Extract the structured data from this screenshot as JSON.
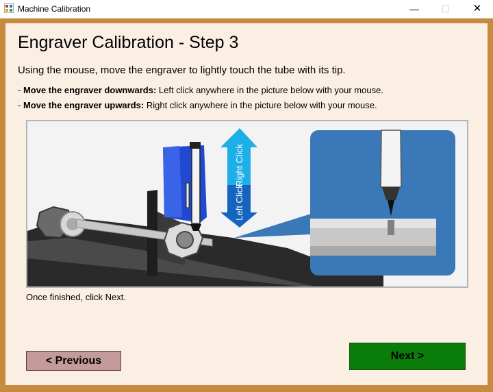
{
  "window": {
    "title": "Machine Calibration",
    "controls": {
      "minimize": "—",
      "maximize": "☐",
      "close": "✕"
    }
  },
  "heading": "Engraver Calibration - Step 3",
  "intro": "Using the mouse, move the engraver to lightly touch the tube with its tip.",
  "instructions": [
    {
      "bold": "Move the engraver downwards:",
      "text": " Left click anywhere in the picture below with your mouse."
    },
    {
      "bold": "Move the engraver upwards:",
      "text": " Right click anywhere in the picture below with your mouse."
    }
  ],
  "picture": {
    "up_label": "Right Click",
    "down_label": "Left Click",
    "colors": {
      "up_arrow": "#1eaee8",
      "down_arrow": "#1565c0",
      "engraver": "#2048d0",
      "inset_bg": "#3a78b8"
    }
  },
  "finished_text": "Once finished, click Next.",
  "buttons": {
    "previous": "< Previous",
    "next": "Next >"
  }
}
